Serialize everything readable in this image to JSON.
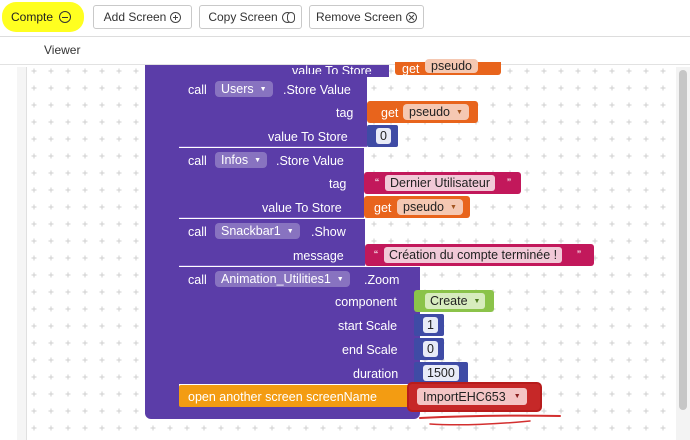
{
  "toolbar": {
    "screen_name": "Compte",
    "add_screen": "Add Screen",
    "copy_screen": "Copy Screen",
    "remove_screen": "Remove Screen"
  },
  "viewer": {
    "label": "Viewer"
  },
  "blocks": {
    "top_partial": {
      "label": "value To Store",
      "get": "get",
      "var": "pseudo"
    },
    "users": {
      "call": "call",
      "component": "Users",
      "method": ".Store Value",
      "tag_label": "tag",
      "tag_get": "get",
      "tag_var": "pseudo",
      "value_label": "value To Store",
      "value": "0"
    },
    "infos": {
      "call": "call",
      "component": "Infos",
      "method": ".Store Value",
      "tag_label": "tag",
      "tag_text": "Dernier Utilisateur",
      "value_label": "value To Store",
      "value_get": "get",
      "value_var": "pseudo"
    },
    "snackbar": {
      "call": "call",
      "component": "Snackbar1",
      "method": ".Show",
      "message_label": "message",
      "message_text": "Création du compte terminée !"
    },
    "animation": {
      "call": "call",
      "component": "Animation_Utilities1",
      "method": ".Zoom",
      "component_label": "component",
      "component_value": "Create",
      "start_label": "start Scale",
      "start_value": "1",
      "end_label": "end Scale",
      "end_value": "0",
      "duration_label": "duration",
      "duration_value": "1500"
    },
    "open_screen": {
      "label": "open another screen  screenName",
      "screen_value": "ImportEHC653"
    },
    "quote_open": "“",
    "quote_close": "”"
  },
  "colors": {
    "procedure": "#5b3da8",
    "getter": "#e8641c",
    "number": "#3f4ba5",
    "text": "#c2185b",
    "component": "#8bc34a",
    "control": "#f39c12",
    "selected": "#c62828",
    "highlight": "#ffff20"
  }
}
